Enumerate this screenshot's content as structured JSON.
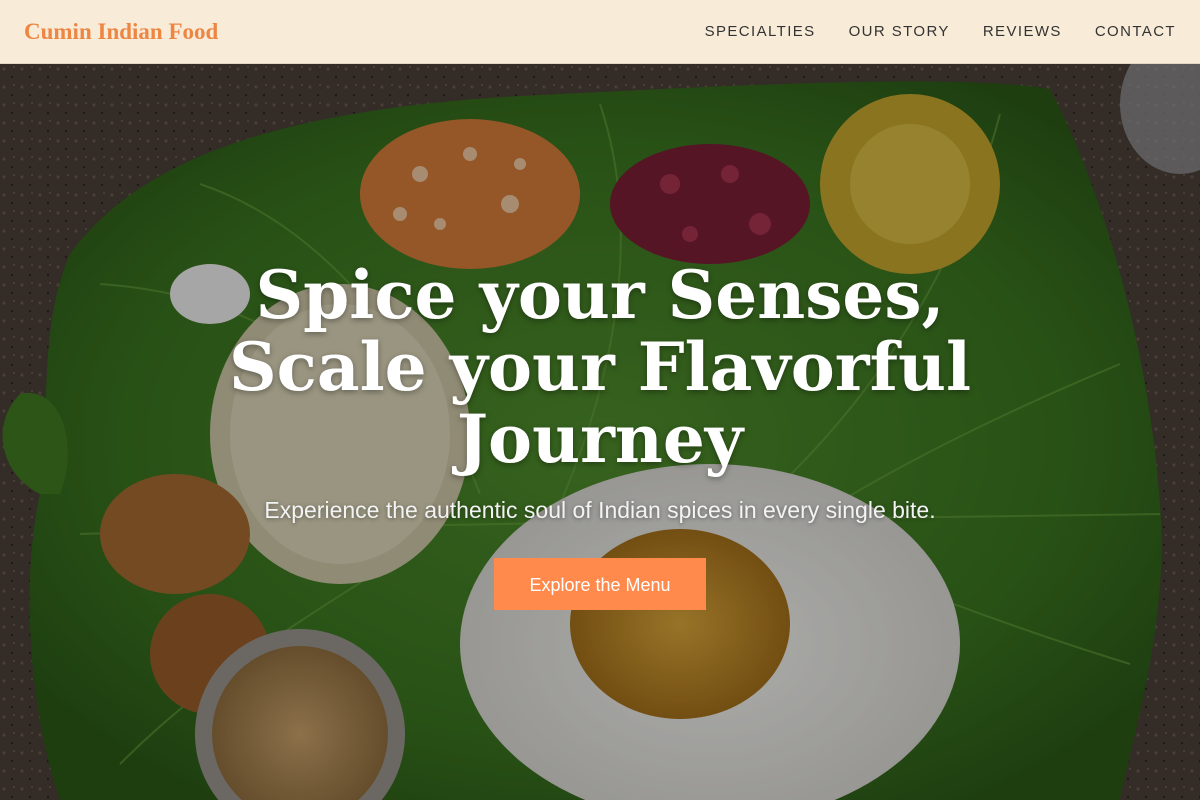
{
  "header": {
    "brand": "Cumin Indian Food",
    "nav": [
      "SPECIALTIES",
      "OUR STORY",
      "REVIEWS",
      "CONTACT"
    ]
  },
  "hero": {
    "title": "Spice your Senses, Scale your Flavorful Journey",
    "subtitle": "Experience the authentic soul of Indian spices in every single bite.",
    "cta_label": "Explore the Menu",
    "background_image": "banana-leaf-thali-photo"
  },
  "colors": {
    "header_bg": "#f8ecd9",
    "brand": "#ee8643",
    "cta_bg": "#ff8a4c",
    "hero_text": "#ffffff"
  }
}
